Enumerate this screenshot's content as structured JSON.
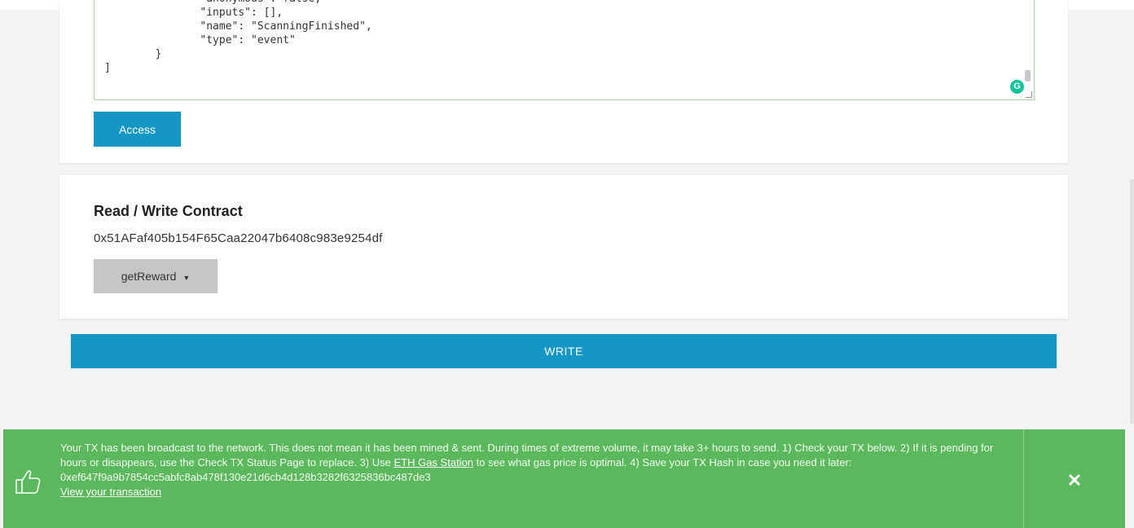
{
  "abi_editor": {
    "lines": [
      "               \"anonymous\": false,",
      "               \"inputs\": [],",
      "               \"name\": \"ScanningFinished\",",
      "               \"type\": \"event\"",
      "        }",
      "]"
    ],
    "grammarly_label": "G"
  },
  "access_button": {
    "label": "Access"
  },
  "contract": {
    "title": "Read / Write Contract",
    "address": "0x51AFaf405b154F65Caa22047b6408c983e9254df",
    "selected_function": "getReward",
    "caret": "▼"
  },
  "write_button": {
    "label": "WRITE"
  },
  "notification": {
    "text_before_link": "Your TX has been broadcast to the network. This does not mean it has been mined & sent. During times of extreme volume, it may take 3+ hours to send. 1) Check your TX below. 2) If it is pending for hours or disappears, use the Check TX Status Page to replace. 3) Use ",
    "gas_link": "ETH Gas Station",
    "text_after_link": " to see what gas price is optimal. 4) Save your TX Hash in case you need it later:",
    "tx_hash": "0xef647f9a9b7854cc5abfc8ab478f130e21d6cb4d128b3282f6325836bc487de3",
    "view_link": "View your transaction",
    "close_symbol": "✕",
    "icon": "thumbs-up-icon",
    "color": "#5cb85c"
  },
  "colors": {
    "accent": "#1497c4",
    "dropdown": "#c6c6c6"
  }
}
